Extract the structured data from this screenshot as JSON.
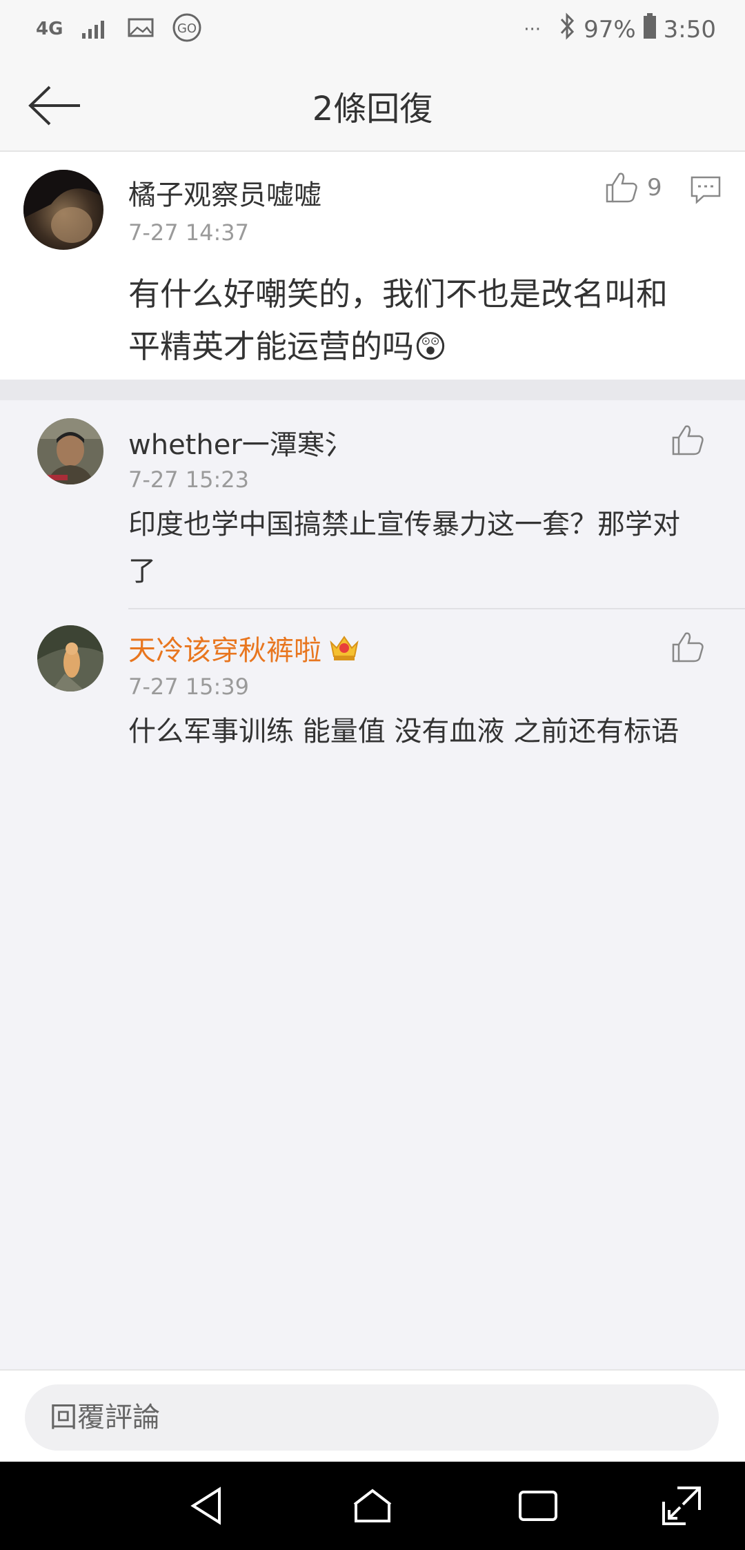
{
  "status_bar": {
    "network": "4G",
    "battery": "97%",
    "time": "3:50",
    "dots": "···",
    "icons": [
      "network-4g-icon",
      "signal-icon",
      "image-icon",
      "go-icon",
      "bluetooth-icon",
      "battery-icon"
    ]
  },
  "header": {
    "title": "2條回復",
    "back_icon": "back-arrow-icon"
  },
  "main_comment": {
    "author": "橘子观察员嘘嘘",
    "time": "7-27 14:37",
    "likes": "9",
    "text_line1": "有什么好嘲笑的，我们不也是改名叫和",
    "text_line2": "平精英才能运营的吗",
    "emoji": "😲"
  },
  "replies": [
    {
      "author": "whether一潭寒氵",
      "time": "7-27 15:23",
      "text_line1": "印度也学中国搞禁止宣传暴力这一套？那学对",
      "text_line2": "了"
    },
    {
      "author": "天冷该穿秋裤啦",
      "author_color": "#e8761f",
      "badge_icon": "crown-badge-icon",
      "time": "7-27 15:39",
      "text_line1": "什么军事训练 能量值 没有血液 之前还有标语"
    }
  ],
  "footer": {
    "reply_placeholder": "回覆評論"
  },
  "system_nav": {
    "buttons": [
      "back-triangle-icon",
      "home-icon",
      "recents-icon",
      "expand-icon"
    ]
  }
}
